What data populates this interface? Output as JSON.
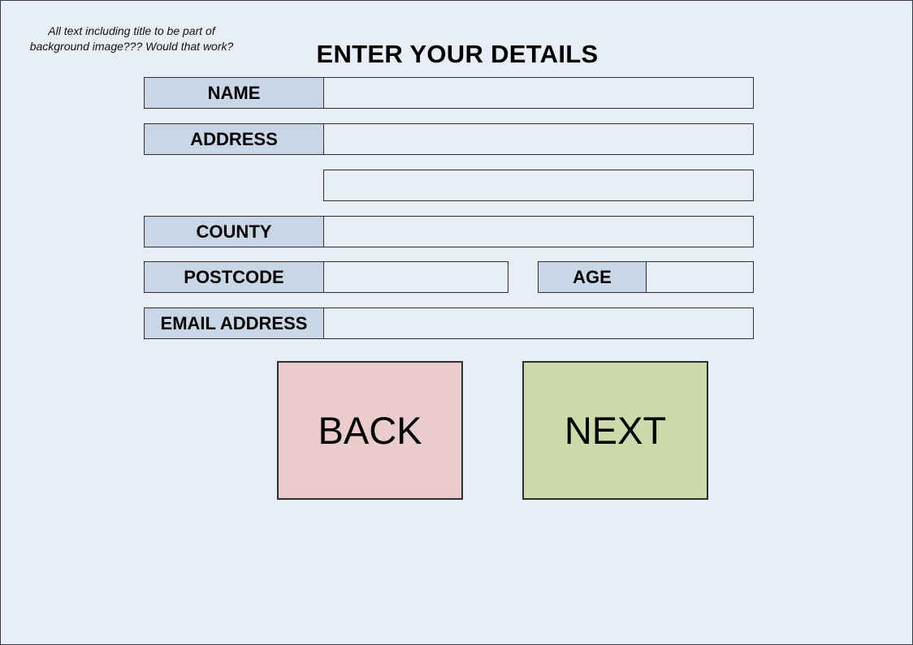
{
  "note": "All text including title to be part of background image??? Would that work?",
  "title": "ENTER YOUR DETAILS",
  "form": {
    "name_label": "NAME",
    "name_value": "",
    "address_label": "ADDRESS",
    "address_line1_value": "",
    "address_line2_value": "",
    "county_label": "COUNTY",
    "county_value": "",
    "postcode_label": "POSTCODE",
    "postcode_value": "",
    "age_label": "AGE",
    "age_value": "",
    "email_label": "EMAIL ADDRESS",
    "email_value": ""
  },
  "buttons": {
    "back_label": "BACK",
    "next_label": "NEXT"
  },
  "colors": {
    "background": "#e8eef8",
    "label_fill": "#c9d6e5",
    "back_fill": "#ebcccc",
    "next_fill": "#ccdaa9"
  }
}
